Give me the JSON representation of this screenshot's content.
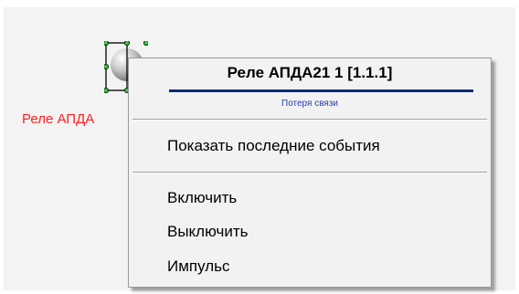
{
  "device": {
    "label": "Реле АПДА",
    "icon": "relay-sphere-icon",
    "label_color": "#ff2020"
  },
  "context_menu": {
    "title": "Реле АПДА21 1 [1.1.1]",
    "status": "Потеря связи",
    "status_color": "#1f3fb0",
    "items": [
      {
        "label": "Показать последние события"
      },
      {
        "label": "Включить"
      },
      {
        "label": "Выключить"
      },
      {
        "label": "Импульс"
      }
    ]
  }
}
